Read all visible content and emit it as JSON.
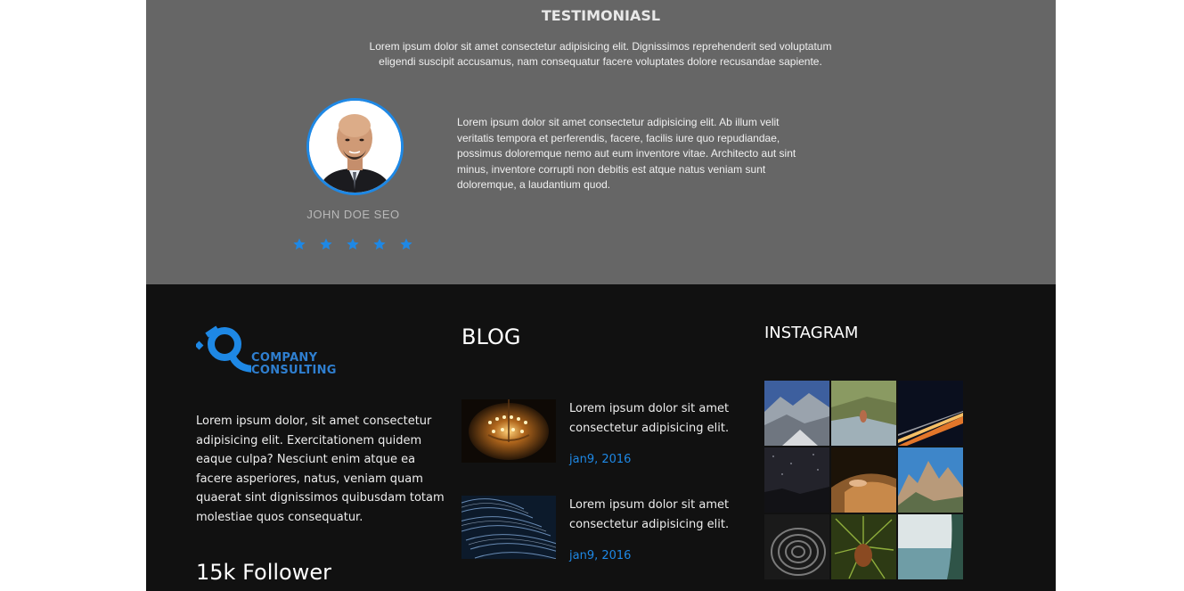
{
  "testimonials": {
    "title": "TESTIMONIASL",
    "intro": "Lorem ipsum dolor sit amet consectetur adipisicing elit. Dignissimos reprehenderit sed voluptatum eligendi suscipit accusamus, nam consequatur facere voluptates dolore recusandae sapiente.",
    "person_name": "JOHN DOE SEO",
    "rating": 5,
    "rating_max": 5,
    "quote": "Lorem ipsum dolor sit amet consectetur adipisicing elit. Ab illum velit veritatis tempora et perferendis, facere, facilis iure quo repudiandae, possimus doloremque nemo aut eum inventore vitae. Architecto aut sint minus, inventore corrupti non debitis est atque natus veniam sunt doloremque, a laudantium quod."
  },
  "footer": {
    "logo": {
      "line1": "COMPANY",
      "line2": "CONSULTING"
    },
    "about": "Lorem ipsum dolor, sit amet consectetur adipisicing elit. Exercitationem quidem eaque culpa? Nesciunt enim atque ea facere asperiores, natus, veniam quam quaerat sint dignissimos quibusdam totam molestiae quos consequatur.",
    "follower": "15k Follower",
    "blog": {
      "heading": "BLOG",
      "posts": [
        {
          "text": "Lorem ipsum dolor sit amet consectetur adipisicing elit.",
          "date": "jan9, 2016",
          "image": "chandelier-photo"
        },
        {
          "text": "Lorem ipsum dolor sit amet consectetur adipisicing elit.",
          "date": "jan9, 2016",
          "image": "star-trails-photo"
        }
      ]
    },
    "instagram": {
      "heading": "INSTAGRAM",
      "images": [
        "mountain-valley-photo",
        "hiker-on-rocks-photo",
        "night-highway-photo",
        "night-sky-photo",
        "sand-dune-photo",
        "rocky-peaks-photo",
        "tunnel-photo",
        "pine-cone-photo",
        "sea-coast-photo"
      ]
    }
  },
  "colors": {
    "testimonial_bg": "#666666",
    "footer_bg": "#111111",
    "accent": "#1e88e5"
  }
}
